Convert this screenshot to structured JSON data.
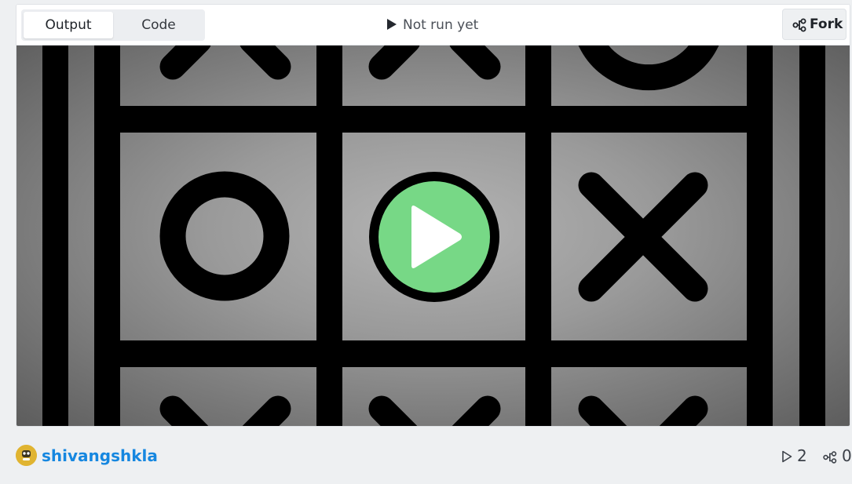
{
  "toolbar": {
    "tabs": [
      {
        "label": "Output",
        "active": true
      },
      {
        "label": "Code",
        "active": false
      }
    ],
    "run_status": "Not run yet",
    "fork_label": "Fork"
  },
  "preview": {
    "icons": [
      "tic-tac-toe-board-thumbnail",
      "play-button-icon"
    ],
    "board_cells_visible": [
      "X",
      "X",
      "O",
      "O",
      "",
      "X",
      "X",
      "X",
      "X"
    ],
    "play_button_color": "#77d886"
  },
  "footer": {
    "author": "shivangshkla",
    "runs": "2",
    "forks": "0"
  },
  "colors": {
    "accent_link": "#1687e0",
    "play_green": "#77d886",
    "avatar_yellow": "#e0b431"
  }
}
